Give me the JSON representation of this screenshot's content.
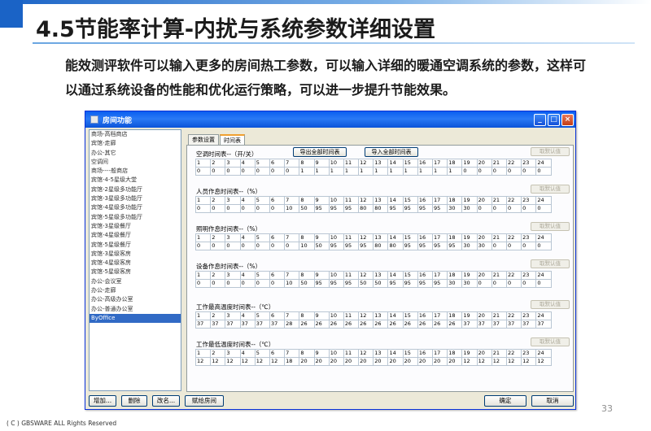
{
  "slide": {
    "title": "4.5节能率计算-内扰与系统参数详细设置",
    "description": "能效测评软件可以输入更多的房间热工参数，可以输入详细的暖通空调系统的参数，这样可以通过系统设备的性能和优化运行策略，可以进一步提升节能效果。",
    "page_number": "33",
    "copyright": "( C ) GBSWARE ALL Rights Reserved"
  },
  "window": {
    "title": "房间功能",
    "controls": {
      "minimize": "_",
      "maximize": "□",
      "close": "×"
    }
  },
  "room_list": [
    "商场-高档商店",
    "宾馆-走廊",
    "办公-其它",
    "空调间",
    "商场----般商店",
    "宾馆-4-5星级大堂",
    "宾馆-2星级多功能厅",
    "宾馆-3星级多功能厅",
    "宾馆-4星级多功能厅",
    "宾馆-5星级多功能厅",
    "宾馆-3星级餐厅",
    "宾馆-4星级餐厅",
    "宾馆-5星级餐厅",
    "宾馆-3星级客房",
    "宾馆-4星级客房",
    "宾馆-5星级客房",
    "办公-会议室",
    "办公-走廊",
    "办公-高级办公室",
    "办公-普通办公室",
    "ByOffice"
  ],
  "selected_room": "ByOffice",
  "tabs": [
    "参数设置",
    "时间表"
  ],
  "active_tab": "时间表",
  "buttons": {
    "export_all": "导出全部时间表",
    "import_all": "导入全部时间表",
    "reset_default": "取默认值",
    "add": "增加...",
    "delete": "删除",
    "rename": "改名...",
    "assign": "赋给房间",
    "ok": "确定",
    "cancel": "取消"
  },
  "hours": [
    "1",
    "2",
    "3",
    "4",
    "5",
    "6",
    "7",
    "8",
    "9",
    "10",
    "11",
    "12",
    "13",
    "14",
    "15",
    "16",
    "17",
    "18",
    "19",
    "20",
    "21",
    "22",
    "23",
    "24"
  ],
  "schedules": [
    {
      "title": "空调时间表--（开/关）",
      "values": [
        "0",
        "0",
        "0",
        "0",
        "0",
        "0",
        "0",
        "1",
        "1",
        "1",
        "1",
        "1",
        "1",
        "1",
        "1",
        "1",
        "1",
        "1",
        "0",
        "0",
        "0",
        "0",
        "0",
        "0"
      ]
    },
    {
      "title": "人员作息时间表--（%）",
      "values": [
        "0",
        "0",
        "0",
        "0",
        "0",
        "0",
        "10",
        "50",
        "95",
        "95",
        "95",
        "80",
        "80",
        "95",
        "95",
        "95",
        "95",
        "30",
        "30",
        "0",
        "0",
        "0",
        "0",
        "0"
      ]
    },
    {
      "title": "照明作息时间表--（%）",
      "values": [
        "0",
        "0",
        "0",
        "0",
        "0",
        "0",
        "0",
        "10",
        "50",
        "95",
        "95",
        "95",
        "80",
        "80",
        "95",
        "95",
        "95",
        "95",
        "30",
        "30",
        "0",
        "0",
        "0",
        "0"
      ]
    },
    {
      "title": "设备作息时间表--（%）",
      "values": [
        "0",
        "0",
        "0",
        "0",
        "0",
        "0",
        "10",
        "50",
        "95",
        "95",
        "95",
        "50",
        "50",
        "95",
        "95",
        "95",
        "95",
        "30",
        "30",
        "0",
        "0",
        "0",
        "0",
        "0"
      ]
    },
    {
      "title": "工作最高温度时间表--（℃）",
      "values": [
        "37",
        "37",
        "37",
        "37",
        "37",
        "37",
        "28",
        "26",
        "26",
        "26",
        "26",
        "26",
        "26",
        "26",
        "26",
        "26",
        "26",
        "26",
        "37",
        "37",
        "37",
        "37",
        "37",
        "37"
      ]
    },
    {
      "title": "工作最低温度时间表--（℃）",
      "values": [
        "12",
        "12",
        "12",
        "12",
        "12",
        "12",
        "18",
        "20",
        "20",
        "20",
        "20",
        "20",
        "20",
        "20",
        "20",
        "20",
        "20",
        "20",
        "12",
        "12",
        "12",
        "12",
        "12",
        "12"
      ]
    }
  ]
}
